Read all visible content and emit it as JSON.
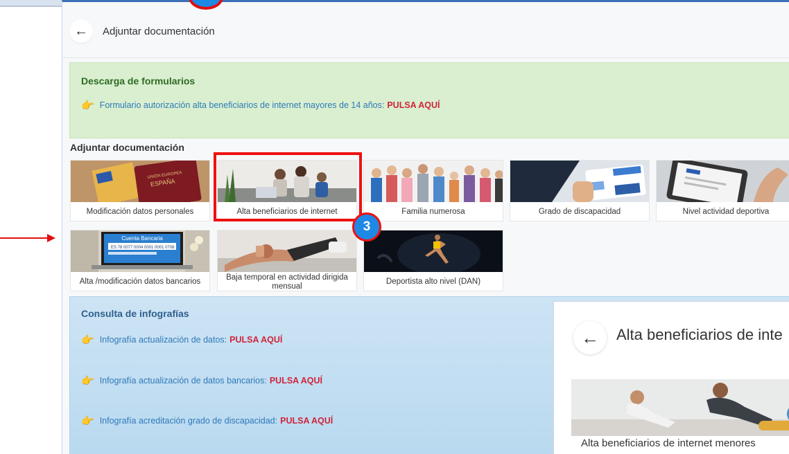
{
  "header": {
    "back_icon": "arrow-left-icon",
    "title": "Adjuntar documentación"
  },
  "downloads": {
    "title": "Descarga de formularios",
    "links": [
      {
        "text": "Formulario autorización alta beneficiarios de internet mayores de 14 años:",
        "cta": "PULSA AQUÍ"
      }
    ]
  },
  "attach_section": {
    "title": "Adjuntar documentación",
    "cards": [
      {
        "label": "Modificación datos personales",
        "image": "passport-image"
      },
      {
        "label": "Alta beneficiarios de internet",
        "image": "family-laptop-image"
      },
      {
        "label": "Familia numerosa",
        "image": "large-family-image"
      },
      {
        "label": "Grado de discapacidad",
        "image": "disability-card-image"
      },
      {
        "label": "Nivel actividad deportiva",
        "image": "tablet-form-image"
      },
      {
        "label": "Alta /modificación datos bancarios",
        "image": "bank-account-image",
        "image_text": "Cuenta Bancaria"
      },
      {
        "label": "Baja temporal en actividad dirigida mensual",
        "image": "injured-knee-image"
      },
      {
        "label": "Deportista alto nivel (DAN)",
        "image": "athlete-image"
      }
    ]
  },
  "infographics": {
    "title": "Consulta de infografías",
    "links": [
      {
        "text": "Infografía actualización de datos:",
        "cta": "PULSA AQUÍ"
      },
      {
        "text": "Infografía actualización de datos bancarios:",
        "cta": "PULSA AQUÍ"
      },
      {
        "text": "Infografía acreditación grado de discapacidad:",
        "cta": "PULSA AQUÍ"
      }
    ]
  },
  "annotation": {
    "step": "3",
    "highlight_color": "#ee1111",
    "badge_color": "#1e88e5"
  },
  "popup": {
    "title": "Alta beneficiarios de inte",
    "card_label": "Alta beneficiarios de internet menores"
  },
  "colors": {
    "green_bg": "#d9efcf",
    "blue_bg": "#c6e0f3",
    "cta": "#d0243b",
    "link": "#2f79b9"
  }
}
